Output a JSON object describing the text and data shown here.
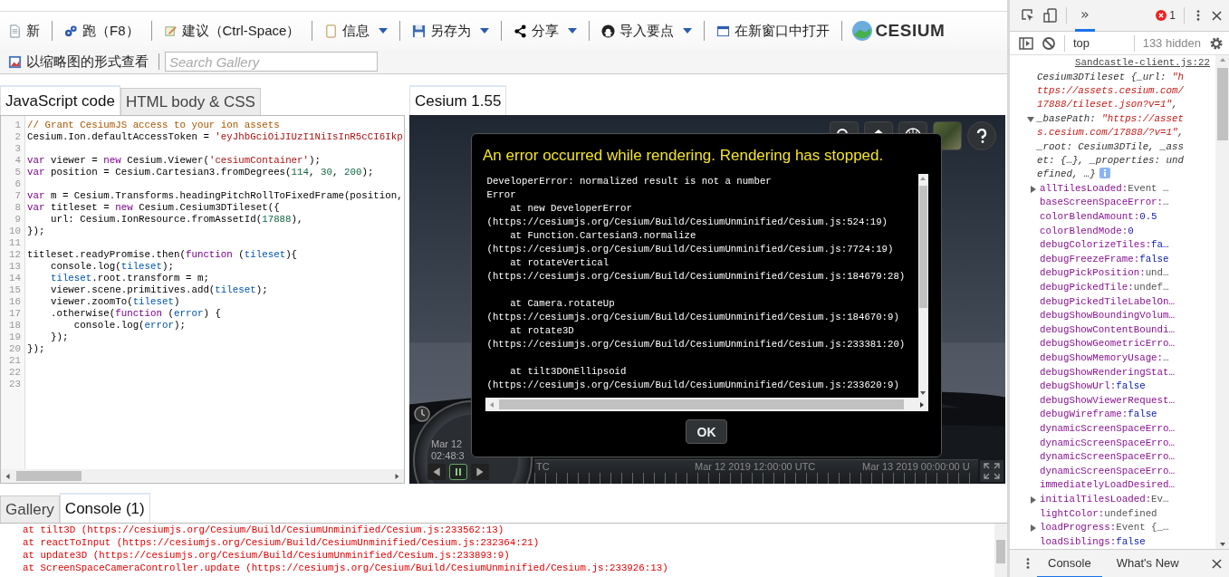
{
  "toolbar": {
    "buttons": [
      {
        "label": "新",
        "dropdown": false
      },
      {
        "label": "跑（F8）",
        "dropdown": false
      },
      {
        "label": "建议（Ctrl-Space）",
        "dropdown": false
      },
      {
        "label": "信息",
        "dropdown": true
      },
      {
        "label": "另存为",
        "dropdown": true
      },
      {
        "label": "分享",
        "dropdown": true
      },
      {
        "label": "导入要点",
        "dropdown": true
      },
      {
        "label": "在新窗口中打开",
        "dropdown": false
      }
    ],
    "logo": "CESIUM",
    "thumbnail_button": "以缩略图的形式查看",
    "search": {
      "placeholder": "Search Gallery"
    }
  },
  "editor": {
    "tabs": [
      {
        "label": "JavaScript code",
        "selected": true
      },
      {
        "label": "HTML body & CSS",
        "selected": false
      }
    ],
    "lines": [
      {
        "number": "1",
        "tokens": [
          {
            "kind": "comment",
            "text": "// Grant CesiumJS access to your ion assets"
          }
        ]
      },
      {
        "number": "2",
        "tokens": [
          {
            "kind": "plain",
            "text": "Cesium.Ion.defaultAccessToken = "
          },
          {
            "kind": "string",
            "text": "'eyJhbGciOiJIUzI1NiIsInR5cCI6Ikp"
          }
        ]
      },
      {
        "number": "3"
      },
      {
        "number": "4",
        "tokens": [
          {
            "kind": "keyword",
            "text": "var"
          },
          {
            "kind": "plain",
            "text": " viewer = "
          },
          {
            "kind": "keyword",
            "text": "new"
          },
          {
            "kind": "plain",
            "text": " Cesium.Viewer("
          },
          {
            "kind": "string",
            "text": "'cesiumContainer'"
          },
          {
            "kind": "plain",
            "text": ");"
          }
        ]
      },
      {
        "number": "5",
        "tokens": [
          {
            "kind": "keyword",
            "text": "var"
          },
          {
            "kind": "plain",
            "text": " position = Cesium.Cartesian3.fromDegrees("
          },
          {
            "kind": "number",
            "text": "114"
          },
          {
            "kind": "plain",
            "text": ", "
          },
          {
            "kind": "number",
            "text": "30"
          },
          {
            "kind": "plain",
            "text": ", "
          },
          {
            "kind": "number",
            "text": "200"
          },
          {
            "kind": "plain",
            "text": ");"
          }
        ]
      },
      {
        "number": "6"
      },
      {
        "number": "7",
        "tokens": [
          {
            "kind": "keyword",
            "text": "var"
          },
          {
            "kind": "plain",
            "text": " m = Cesium.Transforms.headingPitchRollToFixedFrame(position,"
          }
        ]
      },
      {
        "number": "8",
        "tokens": [
          {
            "kind": "keyword",
            "text": "var"
          },
          {
            "kind": "plain",
            "text": " titleset = "
          },
          {
            "kind": "keyword",
            "text": "new"
          },
          {
            "kind": "plain",
            "text": " Cesium.Cesium3DTileset({"
          }
        ]
      },
      {
        "number": "9",
        "tokens": [
          {
            "kind": "plain",
            "text": "    url: Cesium.IonResource.fromAssetId("
          },
          {
            "kind": "number",
            "text": "17888"
          },
          {
            "kind": "plain",
            "text": "),"
          }
        ]
      },
      {
        "number": "10",
        "tokens": [
          {
            "kind": "plain",
            "text": "});"
          }
        ]
      },
      {
        "number": "11"
      },
      {
        "number": "12",
        "tokens": [
          {
            "kind": "plain",
            "text": "titleset.readyPromise.then("
          },
          {
            "kind": "keyword",
            "text": "function"
          },
          {
            "kind": "plain",
            "text": " ("
          },
          {
            "kind": "variable",
            "text": "tileset"
          },
          {
            "kind": "plain",
            "text": "){"
          }
        ]
      },
      {
        "number": "13",
        "tokens": [
          {
            "kind": "plain",
            "text": "    console.log("
          },
          {
            "kind": "variable",
            "text": "tileset"
          },
          {
            "kind": "plain",
            "text": ");"
          }
        ]
      },
      {
        "number": "14",
        "tokens": [
          {
            "kind": "variable",
            "text": "    tileset"
          },
          {
            "kind": "plain",
            "text": ".root.transform = m;"
          }
        ]
      },
      {
        "number": "15",
        "tokens": [
          {
            "kind": "plain",
            "text": "    viewer.scene.primitives.add("
          },
          {
            "kind": "variable",
            "text": "tileset"
          },
          {
            "kind": "plain",
            "text": ");"
          }
        ]
      },
      {
        "number": "16",
        "tokens": [
          {
            "kind": "plain",
            "text": "    viewer.zoomTo("
          },
          {
            "kind": "variable",
            "text": "tileset"
          },
          {
            "kind": "plain",
            "text": ")"
          }
        ]
      },
      {
        "number": "17",
        "tokens": [
          {
            "kind": "plain",
            "text": "    .otherwise("
          },
          {
            "kind": "keyword",
            "text": "function"
          },
          {
            "kind": "plain",
            "text": " ("
          },
          {
            "kind": "variable",
            "text": "error"
          },
          {
            "kind": "plain",
            "text": ") {"
          }
        ]
      },
      {
        "number": "18",
        "tokens": [
          {
            "kind": "plain",
            "text": "        console.log("
          },
          {
            "kind": "variable",
            "text": "error"
          },
          {
            "kind": "plain",
            "text": ");"
          }
        ]
      },
      {
        "number": "19",
        "tokens": [
          {
            "kind": "plain",
            "text": "    });"
          }
        ]
      },
      {
        "number": "20",
        "tokens": [
          {
            "kind": "plain",
            "text": "});"
          }
        ]
      },
      {
        "number": "21"
      },
      {
        "number": "22"
      },
      {
        "number": "23"
      }
    ]
  },
  "viewer": {
    "tab": {
      "label": "Cesium 1.55",
      "selected": true
    },
    "clock": {
      "date": "Mar 12",
      "time": "02:48:3"
    },
    "timeline": {
      "labels": [
        "TC",
        "Mar 12 2019 12:00:00 UTC",
        "Mar 13 2019 00:00:00 U"
      ]
    },
    "dialog": {
      "title": "An error occurred while rendering. Rendering has stopped.",
      "blocks": [
        [
          "DeveloperError: normalized result is not a number",
          "Error",
          "    at new DeveloperError",
          "(https://cesiumjs.org/Cesium/Build/CesiumUnminified/Cesium.js:524:19)",
          "    at Function.Cartesian3.normalize",
          "(https://cesiumjs.org/Cesium/Build/CesiumUnminified/Cesium.js:7724:19)",
          "    at rotateVertical",
          "(https://cesiumjs.org/Cesium/Build/CesiumUnminified/Cesium.js:184679:28)"
        ],
        [
          "    at Camera.rotateUp",
          "(https://cesiumjs.org/Cesium/Build/CesiumUnminified/Cesium.js:184670:9)",
          "    at rotate3D",
          "(https://cesiumjs.org/Cesium/Build/CesiumUnminified/Cesium.js:233381:20)"
        ],
        [
          "    at tilt3DOnEllipsoid",
          "(https://cesiumjs.org/Cesium/Build/CesiumUnminified/Cesium.js:233620:9)"
        ]
      ],
      "ok": "OK"
    }
  },
  "bottom": {
    "tabs": [
      {
        "label": "Gallery",
        "selected": false
      },
      {
        "label": "Console (1)",
        "selected": true
      }
    ],
    "console": [
      "at tilt3D (https://cesiumjs.org/Cesium/Build/CesiumUnminified/Cesium.js:233562:13)",
      "at reactToInput (https://cesiumjs.org/Cesium/Build/CesiumUnminified/Cesium.js:232364:21)",
      "at update3D (https://cesiumjs.org/Cesium/Build/CesiumUnminified/Cesium.js:233893:9)",
      "at ScreenSpaceCameraController.update (https://cesiumjs.org/Cesium/Build/CesiumUnminified/Cesium.js:233926:13)"
    ]
  },
  "devtools": {
    "more_tab": {
      "label": "»",
      "selected": true
    },
    "error_count": "1",
    "context": "top",
    "hidden": "133 hidden",
    "source": "Sandcastle-client.js:22",
    "summary": {
      "expanded": true,
      "tokens": [
        {
          "kind": "plain",
          "text": "Cesium3DTileset {_url: "
        },
        {
          "kind": "string",
          "text": "\"https://assets.cesium.com/17888/tileset.json?v=1\""
        },
        {
          "kind": "plain",
          "text": ", _basePath: "
        },
        {
          "kind": "string",
          "text": "\"https://assets.cesium.com/17888/?v=1\""
        },
        {
          "kind": "plain",
          "text": ", _root: Cesium3DTile, _asset: {…}, _properties: undefined, …}"
        }
      ]
    },
    "props": [
      {
        "kind": "object",
        "name": "allTilesLoaded:",
        "value": "Event …"
      },
      {
        "kind": "property",
        "name": "baseScreenSpaceError:",
        "value": "…"
      },
      {
        "kind": "number",
        "name": "colorBlendAmount:",
        "value": "0.5"
      },
      {
        "kind": "number",
        "name": "colorBlendMode:",
        "value": "0"
      },
      {
        "kind": "boolean",
        "name": "debugColorizeTiles:",
        "value": "fa…"
      },
      {
        "kind": "boolean",
        "name": "debugFreezeFrame:",
        "value": "false"
      },
      {
        "kind": "property",
        "name": "debugPickPosition:",
        "value": "und…"
      },
      {
        "kind": "property",
        "name": "debugPickedTile:",
        "value": "undef…"
      },
      {
        "kind": "property",
        "name": "debugPickedTileLabelOn…"
      },
      {
        "kind": "property",
        "name": "debugShowBoundingVolum…"
      },
      {
        "kind": "property",
        "name": "debugShowContentBoundi…"
      },
      {
        "kind": "property",
        "name": "debugShowGeometricErro…"
      },
      {
        "kind": "property",
        "name": "debugShowMemoryUsage:",
        "value": "…"
      },
      {
        "kind": "property",
        "name": "debugShowRenderingStat…"
      },
      {
        "kind": "boolean",
        "name": "debugShowUrl:",
        "value": "false"
      },
      {
        "kind": "property",
        "name": "debugShowViewerRequest…"
      },
      {
        "kind": "boolean",
        "name": "debugWireframe:",
        "value": "false"
      },
      {
        "kind": "property",
        "name": "dynamicScreenSpaceErro…"
      },
      {
        "kind": "property",
        "name": "dynamicScreenSpaceErro…"
      },
      {
        "kind": "property",
        "name": "dynamicScreenSpaceErro…"
      },
      {
        "kind": "property",
        "name": "dynamicScreenSpaceErro…"
      },
      {
        "kind": "property",
        "name": "immediatelyLoadDesired…"
      },
      {
        "kind": "object",
        "name": "initialTilesLoaded:",
        "value": "Ev…"
      },
      {
        "kind": "property",
        "name": "lightColor:",
        "value": "undefined"
      },
      {
        "kind": "object",
        "name": "loadProgress:",
        "value": "Event {_…"
      },
      {
        "kind": "boolean",
        "name": "loadSiblings:",
        "value": "false"
      }
    ],
    "drawer_tabs": [
      {
        "label": "Console",
        "selected": true
      },
      {
        "label": "What's New",
        "selected": false
      }
    ]
  }
}
